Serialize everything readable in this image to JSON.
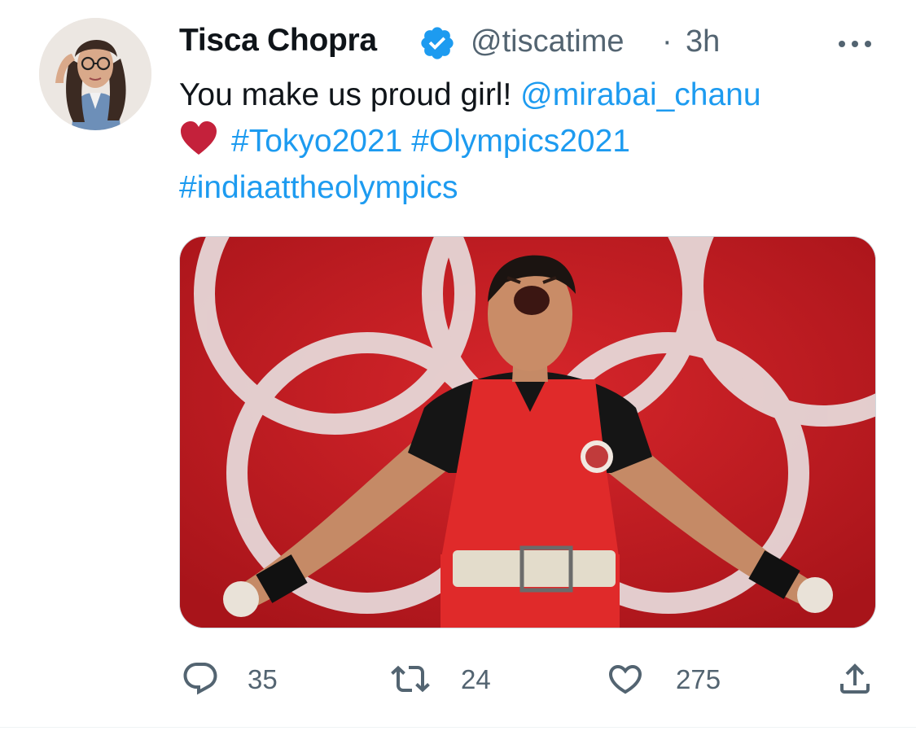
{
  "tweet": {
    "author": {
      "display_name": "Tisca Chopra",
      "handle": "@tiscatime",
      "verified": true
    },
    "separator": "·",
    "time": "3h",
    "text": {
      "line1_plain": "You make us proud girl! ",
      "mention": "@mirabai_chanu",
      "heart_emoji": "red-heart",
      "hashtag1": "#Tokyo2021",
      "hashtag2": "#Olympics2021",
      "hashtag3": "#indiaattheolympics"
    },
    "media": {
      "description_icon": "photo"
    },
    "actions": {
      "reply_count": "35",
      "retweet_count": "24",
      "like_count": "275"
    }
  },
  "colors": {
    "link": "#1d9bf0",
    "secondary_text": "#536471",
    "verified": "#1d9bf0",
    "heart": "#c4213b",
    "media_red": "#c8191e"
  }
}
